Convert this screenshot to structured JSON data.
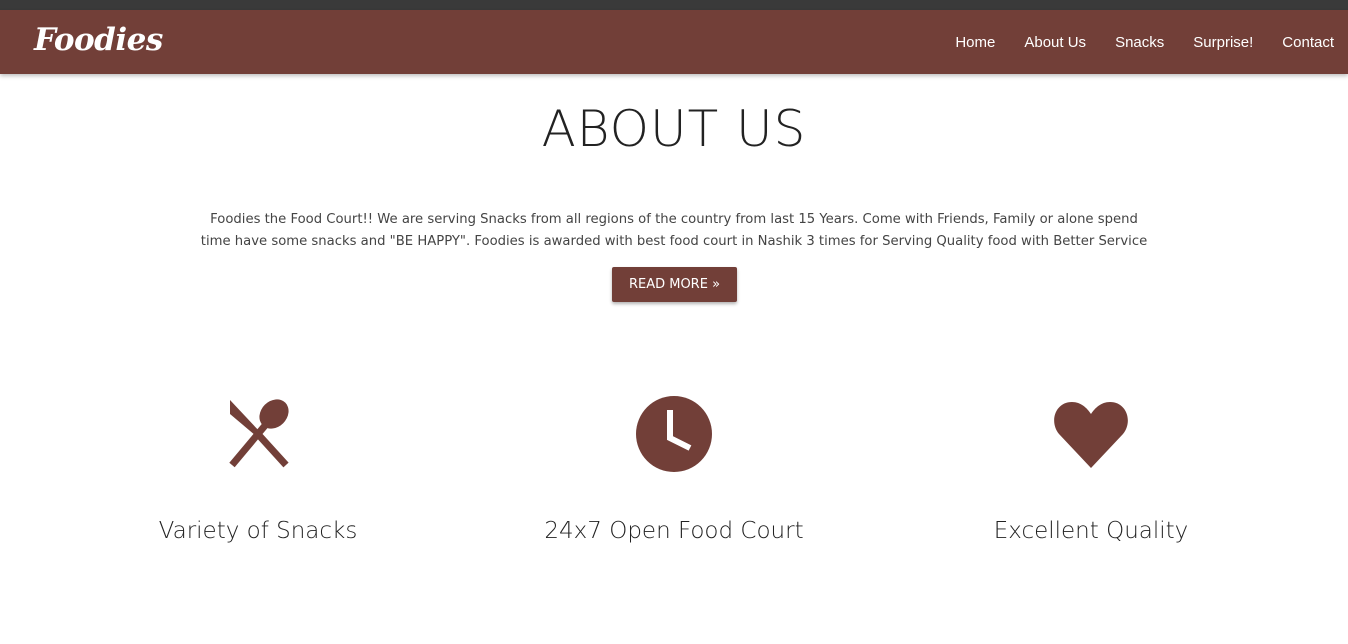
{
  "brand": {
    "name": "Foodies"
  },
  "nav": {
    "items": [
      {
        "label": "Home"
      },
      {
        "label": "About Us"
      },
      {
        "label": "Snacks"
      },
      {
        "label": "Surprise!"
      },
      {
        "label": "Contact"
      }
    ]
  },
  "about": {
    "title": "ABOUT US",
    "text": "Foodies the Food Court!! We are serving Snacks from all regions of the country from last 15 Years. Come with Friends, Family or alone spend time have some snacks and \"BE HAPPY\". Foodies is awarded with best food court in Nashik 3 times for Serving Quality food with Better Service",
    "button_label": "READ MORE »"
  },
  "features": [
    {
      "icon": "utensils-icon",
      "caption": "Variety of Snacks"
    },
    {
      "icon": "clock-icon",
      "caption": "24x7 Open Food Court"
    },
    {
      "icon": "heart-icon",
      "caption": "Excellent Quality"
    }
  ],
  "colors": {
    "accent": "#723f38",
    "top_strip": "#3a3a3a",
    "text_dark": "#222222",
    "text_body": "#444444"
  }
}
